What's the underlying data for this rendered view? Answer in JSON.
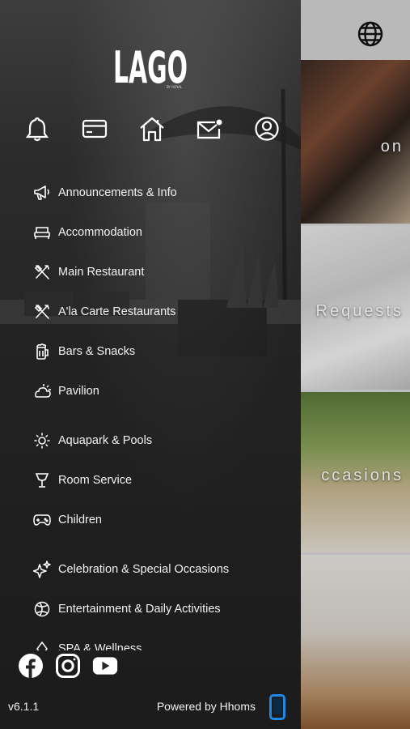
{
  "drawer": {
    "logo_text": "LAGO",
    "logo_subtext": "BY ROYAL",
    "quick_icons": [
      "bell-icon",
      "card-icon",
      "home-icon",
      "mail-icon",
      "profile-icon"
    ],
    "menu_items": [
      {
        "label": "Announcements & Info",
        "icon": "megaphone-icon"
      },
      {
        "label": "Accommodation",
        "icon": "bed-icon"
      },
      {
        "label": "Main Restaurant",
        "icon": "cutlery-icon"
      },
      {
        "label": "A'la Carte Restaurants",
        "icon": "cutlery-icon"
      },
      {
        "label": "Bars & Snacks",
        "icon": "beer-mug-icon"
      },
      {
        "label": "Pavilion",
        "icon": "cloud-sun-icon"
      },
      {
        "label": "Aquapark & Pools",
        "icon": "sun-icon"
      },
      {
        "label": "Room Service",
        "icon": "cocktail-glass-icon"
      },
      {
        "label": "Children",
        "icon": "gamepad-icon"
      },
      {
        "label": "Celebration & Special Occasions",
        "icon": "sparkles-icon"
      },
      {
        "label": "Entertainment & Daily Activities",
        "icon": "ball-icon"
      },
      {
        "label": "SPA & Wellness",
        "icon": "spa-icon"
      }
    ],
    "socials": [
      "facebook-icon",
      "instagram-icon",
      "youtube-icon"
    ],
    "version": "v6.1.1",
    "powered_by": "Powered by Hhoms"
  },
  "background": {
    "tiles": [
      {
        "label": "on"
      },
      {
        "label": "Requests"
      },
      {
        "label": "ccasions"
      },
      {
        "label": ""
      }
    ]
  },
  "colors": {
    "accent_blue": "#1e88e5",
    "drawer_text": "#f2f2f2"
  }
}
